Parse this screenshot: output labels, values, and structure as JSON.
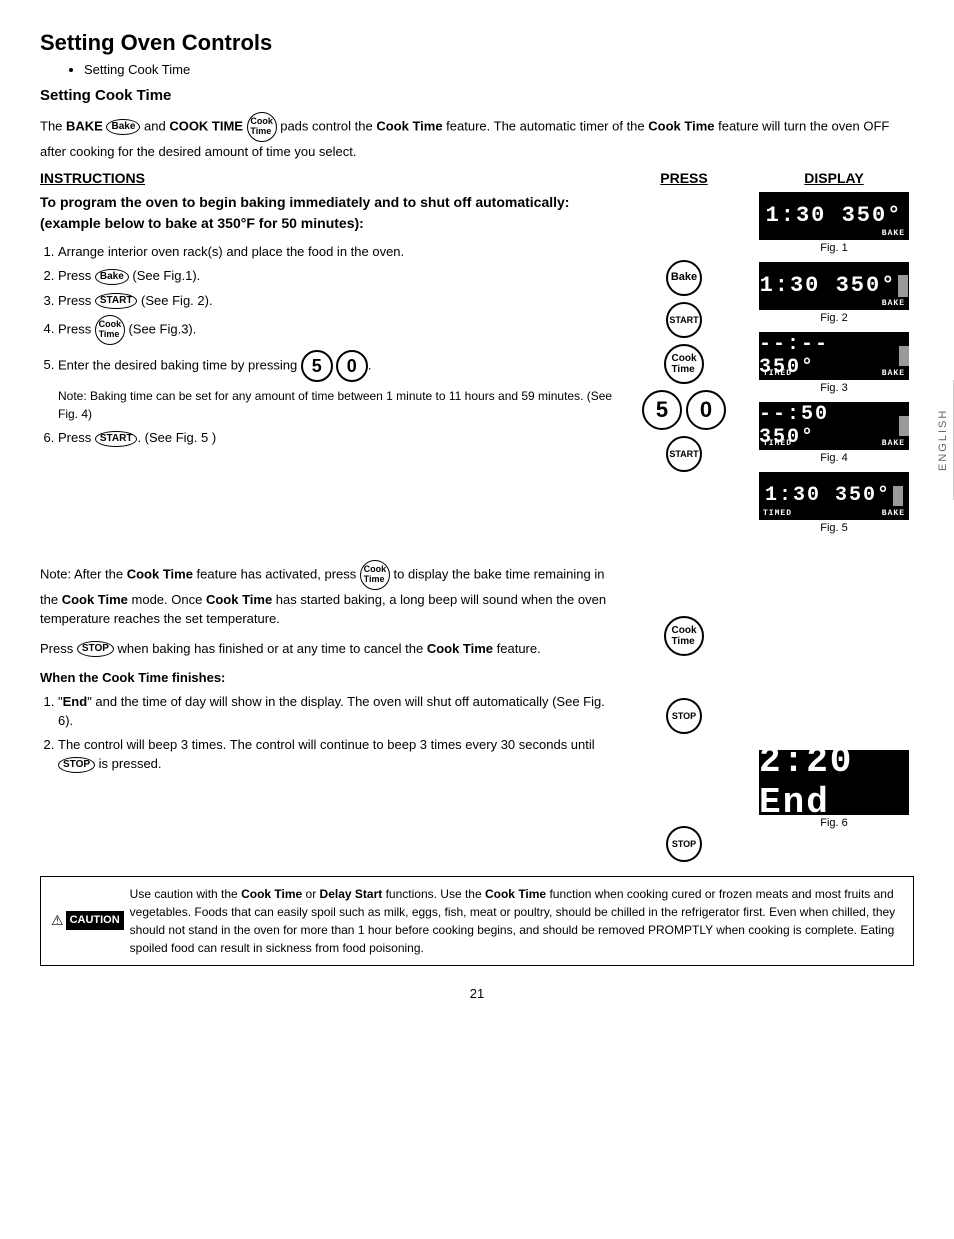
{
  "page": {
    "title": "Setting Oven Controls",
    "bullet": "Setting Cook Time",
    "section_title": "Setting Cook Time",
    "intro": {
      "part1": "The ",
      "bake_label": "BAKE",
      "part2": " and ",
      "cook_time_label": "COOK TIME",
      "part3": " pads control the ",
      "cook_time_bold1": "Cook Time",
      "part4": " feature. The automatic timer of the ",
      "cook_time_bold2": "Cook Time",
      "part5": " feature will turn the oven OFF after cooking for the desired amount of time you select."
    },
    "columns": {
      "instructions": "INSTRUCTIONS",
      "press": "PRESS",
      "display": "DISPLAY"
    },
    "bold_heading": "To program the oven to begin baking immediately and to shut off automatically: (example below to bake at 350°F for 50 minutes):",
    "steps": [
      "Arrange interior oven rack(s) and place the food in the oven.",
      "Press  (See Fig.1).",
      "Press  (See Fig. 2).",
      "Press  (See Fig.3).",
      "Enter the desired baking time by pressing .",
      "Press  (See Fig. 5 )"
    ],
    "note1": "Note: Baking time can be set for any amount of time between 1 minute to 11 hours and 59 minutes. (See Fig. 4)",
    "para1": "Note: After the ",
    "para1_bold1": "Cook Time",
    "para1_2": " feature has activated, press ",
    "para1_3": " to display the bake time remaining in the ",
    "para1_bold2": "Cook Time",
    "para1_4": " mode. Once ",
    "para1_bold3": "Cook Time",
    "para1_5": " has started baking, a long beep will sound when the oven temperature reaches the set temperature.",
    "para2": "Press ",
    "para2_2": " when baking has finished or at any time to cancel the ",
    "para2_bold": "Cook Time",
    "para2_3": " feature.",
    "when_heading": "When the Cook Time finishes:",
    "when_items": [
      "\"End\" and the time of day will show in the display. The oven will shut off automatically (See Fig. 6).",
      "The control will beep 3 times. The control will continue to beep 3 times every 30 seconds until  is pressed."
    ],
    "caution_text": " Use caution with the Cook Time or Delay Start functions. Use the Cook Time function when cooking cured or frozen meats and most fruits and vegetables. Foods that can easily spoil such as milk, eggs, fish, meat or poultry, should be chilled in the refrigerator first. Even when chilled, they should not stand in the oven for more than 1 hour before cooking begins, and should be removed PROMPTLY when cooking is complete. Eating spoiled food can result in sickness from food poisoning.",
    "page_number": "21",
    "displays": [
      {
        "id": "fig1",
        "text": "1:30 350",
        "labels": [
          "BAKE"
        ],
        "timed": false,
        "cursor": false
      },
      {
        "id": "fig2",
        "text": "1:30 350",
        "labels": [
          "BAKE"
        ],
        "timed": false,
        "cursor": true
      },
      {
        "id": "fig3",
        "text": "--:-- 350",
        "labels": [
          "TIMED",
          "BAKE"
        ],
        "timed": true,
        "cursor": true
      },
      {
        "id": "fig4",
        "text": "--:50 350",
        "labels": [
          "TIMED",
          "BAKE"
        ],
        "timed": true,
        "cursor": true
      },
      {
        "id": "fig5",
        "text": "1:30 350",
        "labels": [
          "TIMED",
          "BAKE"
        ],
        "timed": true,
        "cursor": true
      },
      {
        "id": "fig6",
        "text": "2:20 End",
        "labels": [],
        "timed": false,
        "cursor": false
      }
    ],
    "fig_labels": [
      "Fig. 1",
      "Fig. 2",
      "Fig. 3",
      "Fig. 4",
      "Fig. 5",
      "Fig. 6"
    ],
    "side_tab": "ENGLISH"
  }
}
